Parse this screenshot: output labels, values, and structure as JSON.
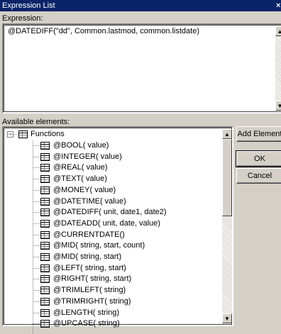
{
  "window": {
    "title": "Expression List"
  },
  "expression": {
    "label": "Expression:",
    "value": "@DATEDIFF(\"dd\", Common.lastmod, common.listdate)"
  },
  "available": {
    "label": "Available elements:",
    "root": "Functions",
    "items": [
      "@BOOL( value)",
      "@INTEGER( value)",
      "@REAL( value)",
      "@TEXT( value)",
      "@MONEY( value)",
      "@DATETIME( value)",
      "@DATEDIFF( unit, date1, date2)",
      "@DATEADD( unit, date, value)",
      "@CURRENTDATE()",
      "@MID( string, start, count)",
      "@MID( string, start)",
      "@LEFT( string, start)",
      "@RIGHT( string, start)",
      "@TRIMLEFT( string)",
      "@TRIMRIGHT( string)",
      "@LENGTH( string)",
      "@UPCASE( string)"
    ]
  },
  "buttons": {
    "add_element": "Add Element",
    "ok": "OK",
    "cancel": "Cancel"
  }
}
